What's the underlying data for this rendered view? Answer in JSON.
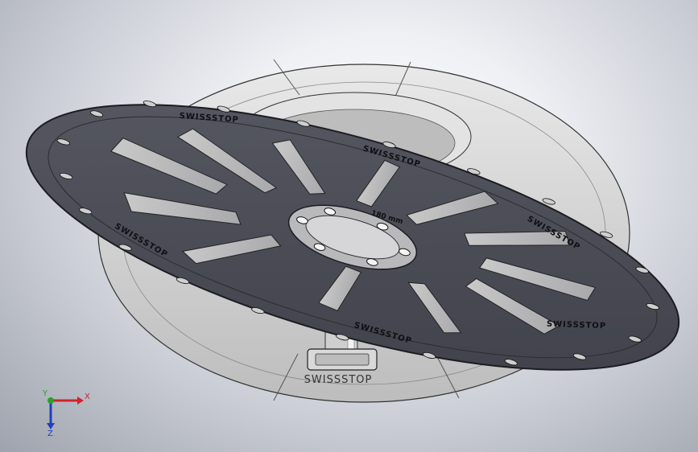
{
  "viewport": {
    "background_top": "#ffffff",
    "background_edge": "#9ea3ad"
  },
  "model": {
    "rotor_brand": "SWISSSTOP",
    "rotor_size_label": "180 mm",
    "base_brand": "SWISSSTOP",
    "rotor_color": "#4a4b54",
    "rotor_edge_color": "#1c1c22",
    "base_color": "#cfcfcf"
  },
  "triad": {
    "x_label": "X",
    "y_label": "Y",
    "z_label": "Z",
    "x_color": "#d2232a",
    "y_color": "#2aa02a",
    "z_color": "#1f3fbf"
  }
}
